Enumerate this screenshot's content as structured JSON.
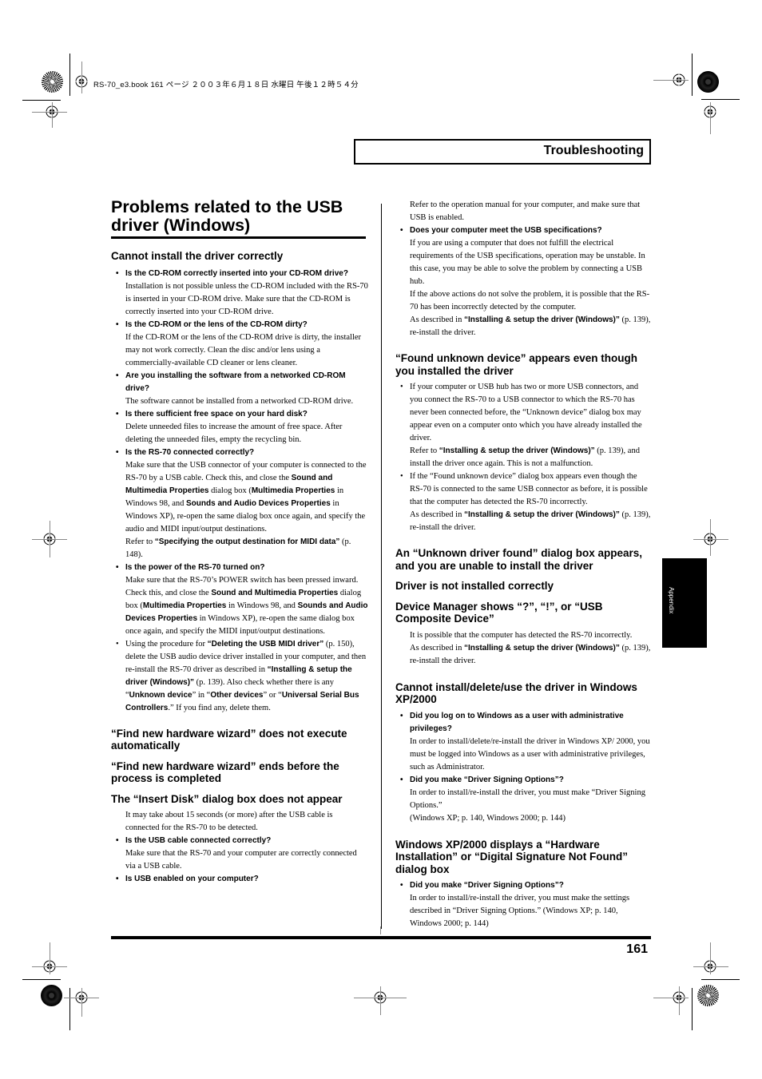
{
  "slug": "RS-70_e3.book  161 ページ  ２００３年６月１８日  水曜日  午後１２時５４分",
  "header": {
    "section": "Troubleshooting"
  },
  "side_tab": "Appendix",
  "page_number": "161",
  "left": {
    "title": "Problems related to the USB driver (Windows)",
    "s1": {
      "heading": "Cannot install the driver correctly",
      "q1": "Is the CD-ROM correctly inserted into your CD-ROM drive?",
      "a1": "Installation is not possible unless the CD-ROM included with the RS-70 is inserted in your CD-ROM drive. Make sure that the CD-ROM is correctly inserted into your CD-ROM drive.",
      "q2": "Is the CD-ROM or the lens of the CD-ROM dirty?",
      "a2": "If the CD-ROM or the lens of the CD-ROM drive is dirty, the installer may not work correctly. Clean the disc and/or lens using a commercially-available CD cleaner or lens cleaner.",
      "q3": "Are you installing the software from a networked CD-ROM drive?",
      "a3": "The software cannot be installed from a networked CD-ROM drive.",
      "q4": "Is there sufficient free space on your hard disk?",
      "a4": "Delete unneeded files to increase the amount of free space. After deleting the unneeded files, empty the recycling bin.",
      "q5": "Is the RS-70 connected correctly?",
      "a5_1": "Make sure that the USB connector of your computer is connected to the RS-70 by a USB cable. Check this, and close the ",
      "a5_b1": "Sound and Multimedia Properties",
      "a5_2": " dialog box (",
      "a5_b2": "Multimedia Properties",
      "a5_3": " in Windows 98, and ",
      "a5_b3": "Sounds and Audio Devices Properties",
      "a5_4": " in Windows XP), re-open the same dialog box once again, and specify the audio and MIDI input/output destinations.",
      "a5_ref1": "Refer to ",
      "a5_refb": "“Specifying the output destination for MIDI data”",
      "a5_ref2": " (p. 148).",
      "q6": "Is the power of the RS-70 turned on?",
      "a6_1": "Make sure that the RS-70’s POWER switch has been pressed inward. Check this, and close the ",
      "a6_b1": "Sound and Multimedia Properties",
      "a6_2": " dialog box (",
      "a6_b2": "Multimedia Properties",
      "a6_3": " in Windows 98, and ",
      "a6_b3": "Sounds and Audio Devices Properties",
      "a6_4": " in Windows XP), re-open the same dialog box once again, and specify the MIDI input/output destinations.",
      "p7_1": "Using the procedure for ",
      "p7_b1": "“Deleting the USB MIDI driver”",
      "p7_2": " (p. 150), delete the USB audio device driver installed in your computer, and then re-install the RS-70 driver as described in ",
      "p7_b2": "“Installing & setup the driver (Windows)”",
      "p7_3": " (p. 139). Also check whether there is any “",
      "p7_b3": "Unknown device",
      "p7_4": "” in “",
      "p7_b4": "Other devices",
      "p7_5": "” or “",
      "p7_b5": "Universal Serial Bus Controllers",
      "p7_6": ".” If you find any, delete them."
    },
    "h2": "“Find new hardware wizard” does not execute automatically",
    "h3": "“Find new hardware wizard” ends before the process is completed",
    "h4": "The “Insert Disk” dialog box does not appear",
    "s4": {
      "intro": "It may take about 15 seconds (or more) after the USB cable is connected for the RS-70 to be detected.",
      "q1": "Is the USB cable connected correctly?",
      "a1": "Make sure that the RS-70 and your computer are correctly connected via a USB cable.",
      "q2": "Is USB enabled on your computer?"
    }
  },
  "right": {
    "a_usb": "Refer to the operation manual for your computer, and make sure that USB is enabled.",
    "q_spec": "Does your computer meet the USB specifications?",
    "a_spec1": "If you are using a computer that does not fulfill the electrical requirements of the USB specifications, operation may be unstable. In this case, you may be able to solve the problem by connecting a USB hub.",
    "a_spec2": "If the above actions do not solve the problem, it is possible that the RS-70 has been incorrectly detected by the computer.",
    "as_described": "As described in ",
    "link_install": "“Installing & setup the driver (Windows)”",
    "reinstall": " (p. 139), re-install the driver.",
    "h_found": "“Found unknown device” appears even though you installed the driver",
    "f1": "If your computer or USB hub has two or more USB connectors, and you connect the RS-70 to a USB connector to which the RS-70 has never been connected before, the “Unknown device” dialog box may appear even on a computer onto which you have already installed the driver.",
    "f1_ref1": "Refer to ",
    "f1_ref2": " (p. 139), and install the driver once again. This is not a malfunction.",
    "f2": "If the “Found unknown device” dialog box appears even though the RS-70 is connected to the same USB connector as before, it is possible that the computer has detected the RS-70 incorrectly.",
    "h_unknown": "An “Unknown driver found” dialog box appears, and you are unable to install the driver",
    "h_notinst": "Driver is not installed correctly",
    "h_devmgr": "Device Manager shows “?”, “!”, or “USB Composite Device”",
    "d1": "It is possible that the computer has detected the RS-70 incorrectly.",
    "h_xp": "Cannot install/delete/use the driver in Windows XP/2000",
    "x_q1": "Did you log on to Windows as a user with administrative privileges?",
    "x_a1": "In order to install/delete/re-install the driver in Windows XP/ 2000, you must be logged into Windows as a user with administrative privileges, such as Administrator.",
    "x_q2": "Did you make “Driver Signing Options”?",
    "x_a2": "In order to install/re-install the driver, you must make “Driver Signing Options.”",
    "x_a2b": "(Windows XP; p. 140, Windows 2000; p. 144)",
    "h_sig": "Windows XP/2000 displays a “Hardware Installation” or “Digital Signature Not Found” dialog box",
    "s_q": "Did you make “Driver Signing Options”?",
    "s_a": "In order to install/re-install the driver, you must make the settings described in “Driver Signing Options.” (Windows XP; p. 140, Windows 2000; p. 144)"
  }
}
